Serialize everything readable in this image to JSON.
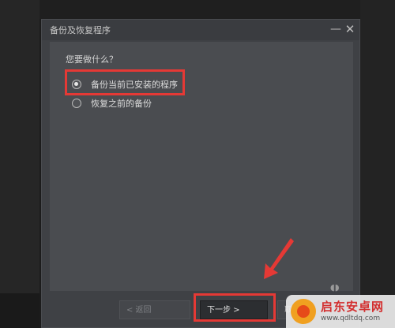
{
  "dialog": {
    "title": "备份及恢复程序",
    "min_glyph": "—",
    "close_glyph": "✕"
  },
  "content": {
    "prompt": "您要做什么？",
    "options": [
      {
        "label": "备份当前已安装的程序",
        "selected": true
      },
      {
        "label": "恢复之前的备份",
        "selected": false
      }
    ]
  },
  "footer": {
    "back_label": "< 返回",
    "next_label": "下一步 >",
    "cancel_label": "取"
  },
  "logo": {
    "text": "启东安卓网",
    "url": "www.qdltdq.com"
  },
  "colors": {
    "highlight": "#e53935",
    "dialog_bg": "#3f4145",
    "content_bg": "#4a4c50"
  }
}
